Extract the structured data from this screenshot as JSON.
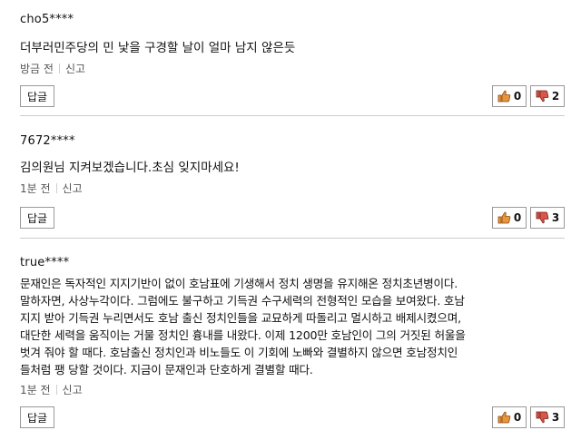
{
  "colors": {
    "thumb_up_fill": "#e8963c",
    "thumb_down_fill": "#d9574a",
    "separator": "#cccccc"
  },
  "comments": [
    {
      "user": "cho5****",
      "text": "더부러민주당의 민 낯을 구경할 날이 얼마 남지 않은듯",
      "time": "방금 전",
      "report_label": "신고",
      "reply_label": "답글",
      "likes": "0",
      "dislikes": "2"
    },
    {
      "user": "7672****",
      "text": "김의원님 지켜보겠습니다.초심 잊지마세요!",
      "time": "1분 전",
      "report_label": "신고",
      "reply_label": "답글",
      "likes": "0",
      "dislikes": "3"
    },
    {
      "user": "true****",
      "text": "문재인은 독자적인 지지기반이 없이 호남표에 기생해서 정치 생명을 유지해온 정치초년병이다.\n말하자면, 사상누각이다. 그럼에도 불구하고 기득권 수구세력의 전형적인 모습을 보여왔다. 호남\n지지 받아 기득권 누리면서도 호남 출신 정치인들을 교묘하게 따돌리고 멀시하고 배제시켰으며,\n대단한 세력을 움직이는 거물 정치인 흉내를 내왔다. 이제 1200만 호남인이 그의 거짓된 허울을\n벗겨 줘야 할 때다. 호남출신 정치인과 비노들도 이 기회에 노빠와 결별하지 않으면 호남정치인\n들처럼 팽 당할 것이다. 지금이 문재인과 단호하게 결별할 때다.",
      "time": "1분 전",
      "report_label": "신고",
      "reply_label": "답글",
      "likes": "0",
      "dislikes": "3"
    }
  ]
}
